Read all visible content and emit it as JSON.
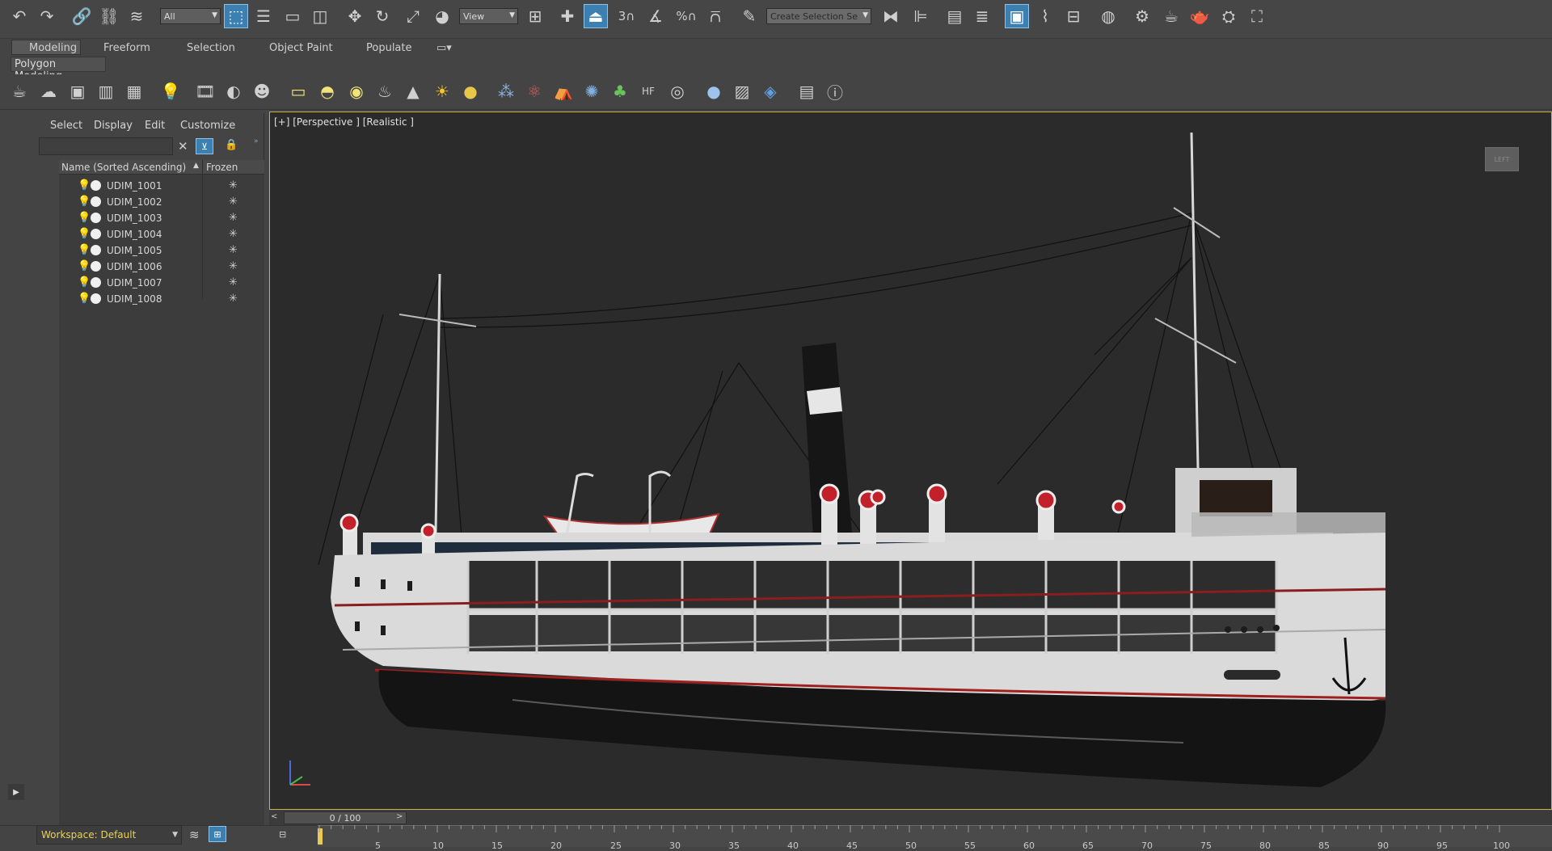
{
  "toolbar": {
    "selection_filter": "All",
    "ref_coord": "View",
    "named_selection_placeholder": "Create Selection Se",
    "snap_label": "3",
    "percent_label": "%"
  },
  "ribbon": {
    "tabs": [
      "Modeling",
      "Freeform",
      "Selection",
      "Object Paint",
      "Populate"
    ],
    "panel_label": "Polygon Modeling"
  },
  "scene_explorer": {
    "menu": [
      "Select",
      "Display",
      "Edit",
      "Customize"
    ],
    "column_name": "Name (Sorted Ascending)",
    "column_frozen": "Frozen",
    "objects": [
      "UDIM_1001",
      "UDIM_1002",
      "UDIM_1003",
      "UDIM_1004",
      "UDIM_1005",
      "UDIM_1006",
      "UDIM_1007",
      "UDIM_1008"
    ]
  },
  "viewport": {
    "label": "[+] [Perspective ] [Realistic ]",
    "viewcube_text": "LEFT"
  },
  "bottom": {
    "workspace": "Workspace: Default",
    "time_slider": "0 / 100",
    "timeline_ticks": [
      "5",
      "10",
      "15",
      "20",
      "25",
      "30",
      "35",
      "40",
      "45",
      "50",
      "55",
      "60",
      "65",
      "70",
      "75",
      "80",
      "85",
      "90",
      "95",
      "100"
    ]
  },
  "colors": {
    "accent": "#3c7fb1",
    "viewport_border": "#c8b042",
    "background": "#444444"
  }
}
